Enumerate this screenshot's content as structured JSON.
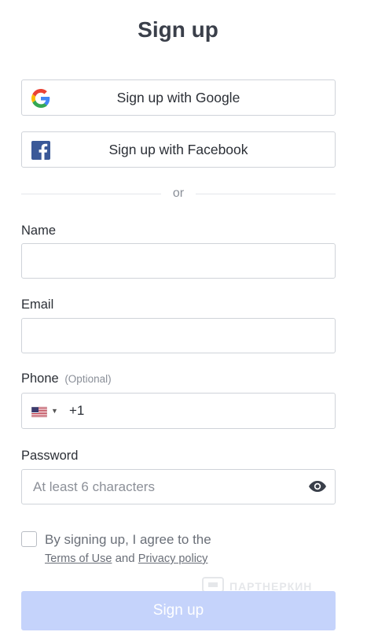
{
  "page": {
    "title": "Sign up"
  },
  "social": {
    "google": {
      "label": "Sign up with Google",
      "icon": "google-icon"
    },
    "facebook": {
      "label": "Sign up with Facebook",
      "icon": "facebook-icon"
    }
  },
  "divider": {
    "text": "or"
  },
  "fields": {
    "name": {
      "label": "Name",
      "value": "",
      "placeholder": ""
    },
    "email": {
      "label": "Email",
      "value": "",
      "placeholder": ""
    },
    "phone": {
      "label": "Phone",
      "optional": "(Optional)",
      "country_flag": "us-flag-icon",
      "dial_code": "+1",
      "value": ""
    },
    "password": {
      "label": "Password",
      "placeholder": "At least 6 characters",
      "toggle_icon": "eye-icon"
    }
  },
  "agreement": {
    "text": "By signing up, I agree to the",
    "terms_link": "Terms of Use",
    "and": "and",
    "privacy_link": "Privacy policy",
    "checked": false
  },
  "submit": {
    "label": "Sign up",
    "color": "#c5d3fb"
  },
  "watermark": {
    "text": "ПАРТНЕРКИН"
  },
  "colors": {
    "facebook": "#3b5998",
    "border": "#cfd3d9",
    "text": "#2b2f36"
  }
}
